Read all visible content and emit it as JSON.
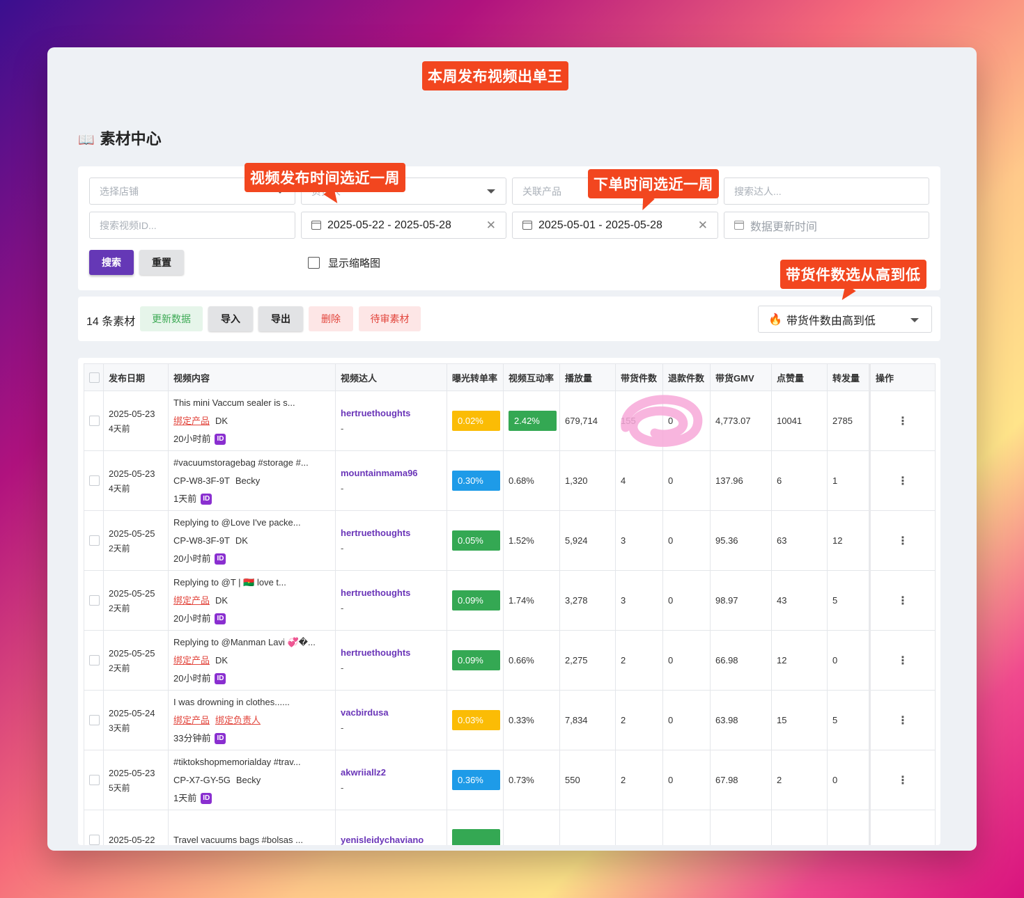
{
  "callouts": {
    "top": "本周发布视频出单王",
    "publish_time": "视频发布时间选近一周",
    "order_time": "下单时间选近一周",
    "sort": "带货件数选从高到低"
  },
  "page": {
    "title_icon": "📖",
    "title": "素材中心"
  },
  "filters": {
    "store_placeholder": "选择店铺",
    "owner_placeholder": "负责人",
    "product_placeholder": "关联产品",
    "creator_placeholder": "搜索达人...",
    "video_id_placeholder": "搜索视频ID...",
    "publish_range": "2025-05-22 - 2025-05-28",
    "order_range": "2025-05-01 - 2025-05-28",
    "update_time_placeholder": "数据更新时间",
    "search_label": "搜索",
    "reset_label": "重置",
    "thumbnail_label": "显示缩略图"
  },
  "actions": {
    "count": "14 条素材",
    "update_label": "更新数据",
    "import_label": "导入",
    "export_label": "导出",
    "delete_label": "删除",
    "pending_label": "待审素材",
    "sort_icon": "🔥",
    "sort_value": "带货件数由高到低"
  },
  "table": {
    "headers": [
      "发布日期",
      "视频内容",
      "视频达人",
      "曝光转单率",
      "视频互动率",
      "播放量",
      "带货件数",
      "退款件数",
      "带货GMV",
      "点赞量",
      "转发量",
      "操作"
    ],
    "rows": [
      {
        "date": "2025-05-23",
        "ago": "4天前",
        "title": "This mini Vaccum sealer is s...",
        "tag1": "绑定产品",
        "tag1_link": true,
        "tag2": "DK",
        "tag2_link": false,
        "updated": "20小时前",
        "creator": "hertruethoughts",
        "dash": "-",
        "conv": "0.02%",
        "conv_color": "#fbbc05",
        "inter": "2.42%",
        "inter_color": "#34a853",
        "views": "679,714",
        "sold": "155",
        "refund": "0",
        "gmv": "4,773.07",
        "likes": "10041",
        "shares": "2785"
      },
      {
        "date": "2025-05-23",
        "ago": "4天前",
        "title": "#vacuumstoragebag #storage #...",
        "tag1": "CP-W8-3F-9T",
        "tag1_link": false,
        "tag2": "Becky",
        "tag2_link": false,
        "updated": "1天前",
        "creator": "mountainmama96",
        "dash": "-",
        "conv": "0.30%",
        "conv_color": "#1e9be8",
        "inter": "0.68%",
        "inter_color": "",
        "views": "1,320",
        "sold": "4",
        "refund": "0",
        "gmv": "137.96",
        "likes": "6",
        "shares": "1"
      },
      {
        "date": "2025-05-25",
        "ago": "2天前",
        "title": "Replying to @Love I've packe...",
        "tag1": "CP-W8-3F-9T",
        "tag1_link": false,
        "tag2": "DK",
        "tag2_link": false,
        "updated": "20小时前",
        "creator": "hertruethoughts",
        "dash": "-",
        "conv": "0.05%",
        "conv_color": "#34a853",
        "inter": "1.52%",
        "inter_color": "",
        "views": "5,924",
        "sold": "3",
        "refund": "0",
        "gmv": "95.36",
        "likes": "63",
        "shares": "12"
      },
      {
        "date": "2025-05-25",
        "ago": "2天前",
        "title": "Replying to @T | 🇧🇫 love t...",
        "tag1": "绑定产品",
        "tag1_link": true,
        "tag2": "DK",
        "tag2_link": false,
        "updated": "20小时前",
        "creator": "hertruethoughts",
        "dash": "-",
        "conv": "0.09%",
        "conv_color": "#34a853",
        "inter": "1.74%",
        "inter_color": "",
        "views": "3,278",
        "sold": "3",
        "refund": "0",
        "gmv": "98.97",
        "likes": "43",
        "shares": "5"
      },
      {
        "date": "2025-05-25",
        "ago": "2天前",
        "title": "Replying to @Manman Lavi 💞�...",
        "tag1": "绑定产品",
        "tag1_link": true,
        "tag2": "DK",
        "tag2_link": false,
        "updated": "20小时前",
        "creator": "hertruethoughts",
        "dash": "-",
        "conv": "0.09%",
        "conv_color": "#34a853",
        "inter": "0.66%",
        "inter_color": "",
        "views": "2,275",
        "sold": "2",
        "refund": "0",
        "gmv": "66.98",
        "likes": "12",
        "shares": "0"
      },
      {
        "date": "2025-05-24",
        "ago": "3天前",
        "title": "I was drowning in clothes......",
        "tag1": "绑定产品",
        "tag1_link": true,
        "tag2": "绑定负责人",
        "tag2_link": true,
        "updated": "33分钟前",
        "creator": "vacbirdusa",
        "dash": "-",
        "conv": "0.03%",
        "conv_color": "#fbbc05",
        "inter": "0.33%",
        "inter_color": "",
        "views": "7,834",
        "sold": "2",
        "refund": "0",
        "gmv": "63.98",
        "likes": "15",
        "shares": "5"
      },
      {
        "date": "2025-05-23",
        "ago": "5天前",
        "title": "#tiktokshopmemorialday #trav...",
        "tag1": "CP-X7-GY-5G",
        "tag1_link": false,
        "tag2": "Becky",
        "tag2_link": false,
        "updated": "1天前",
        "creator": "akwriiallz2",
        "dash": "-",
        "conv": "0.36%",
        "conv_color": "#1e9be8",
        "inter": "0.73%",
        "inter_color": "",
        "views": "550",
        "sold": "2",
        "refund": "0",
        "gmv": "67.98",
        "likes": "2",
        "shares": "0"
      },
      {
        "date": "2025-05-22",
        "ago": "",
        "title": "Travel vacuums bags #bolsas ...",
        "tag1": "",
        "tag1_link": false,
        "tag2": "",
        "tag2_link": false,
        "updated": "",
        "creator": "yenisleidychaviano",
        "dash": "",
        "conv": "",
        "conv_color": "#34a853",
        "inter": "",
        "inter_color": "",
        "views": "",
        "sold": "",
        "refund": "",
        "gmv": "",
        "likes": "",
        "shares": ""
      }
    ]
  }
}
